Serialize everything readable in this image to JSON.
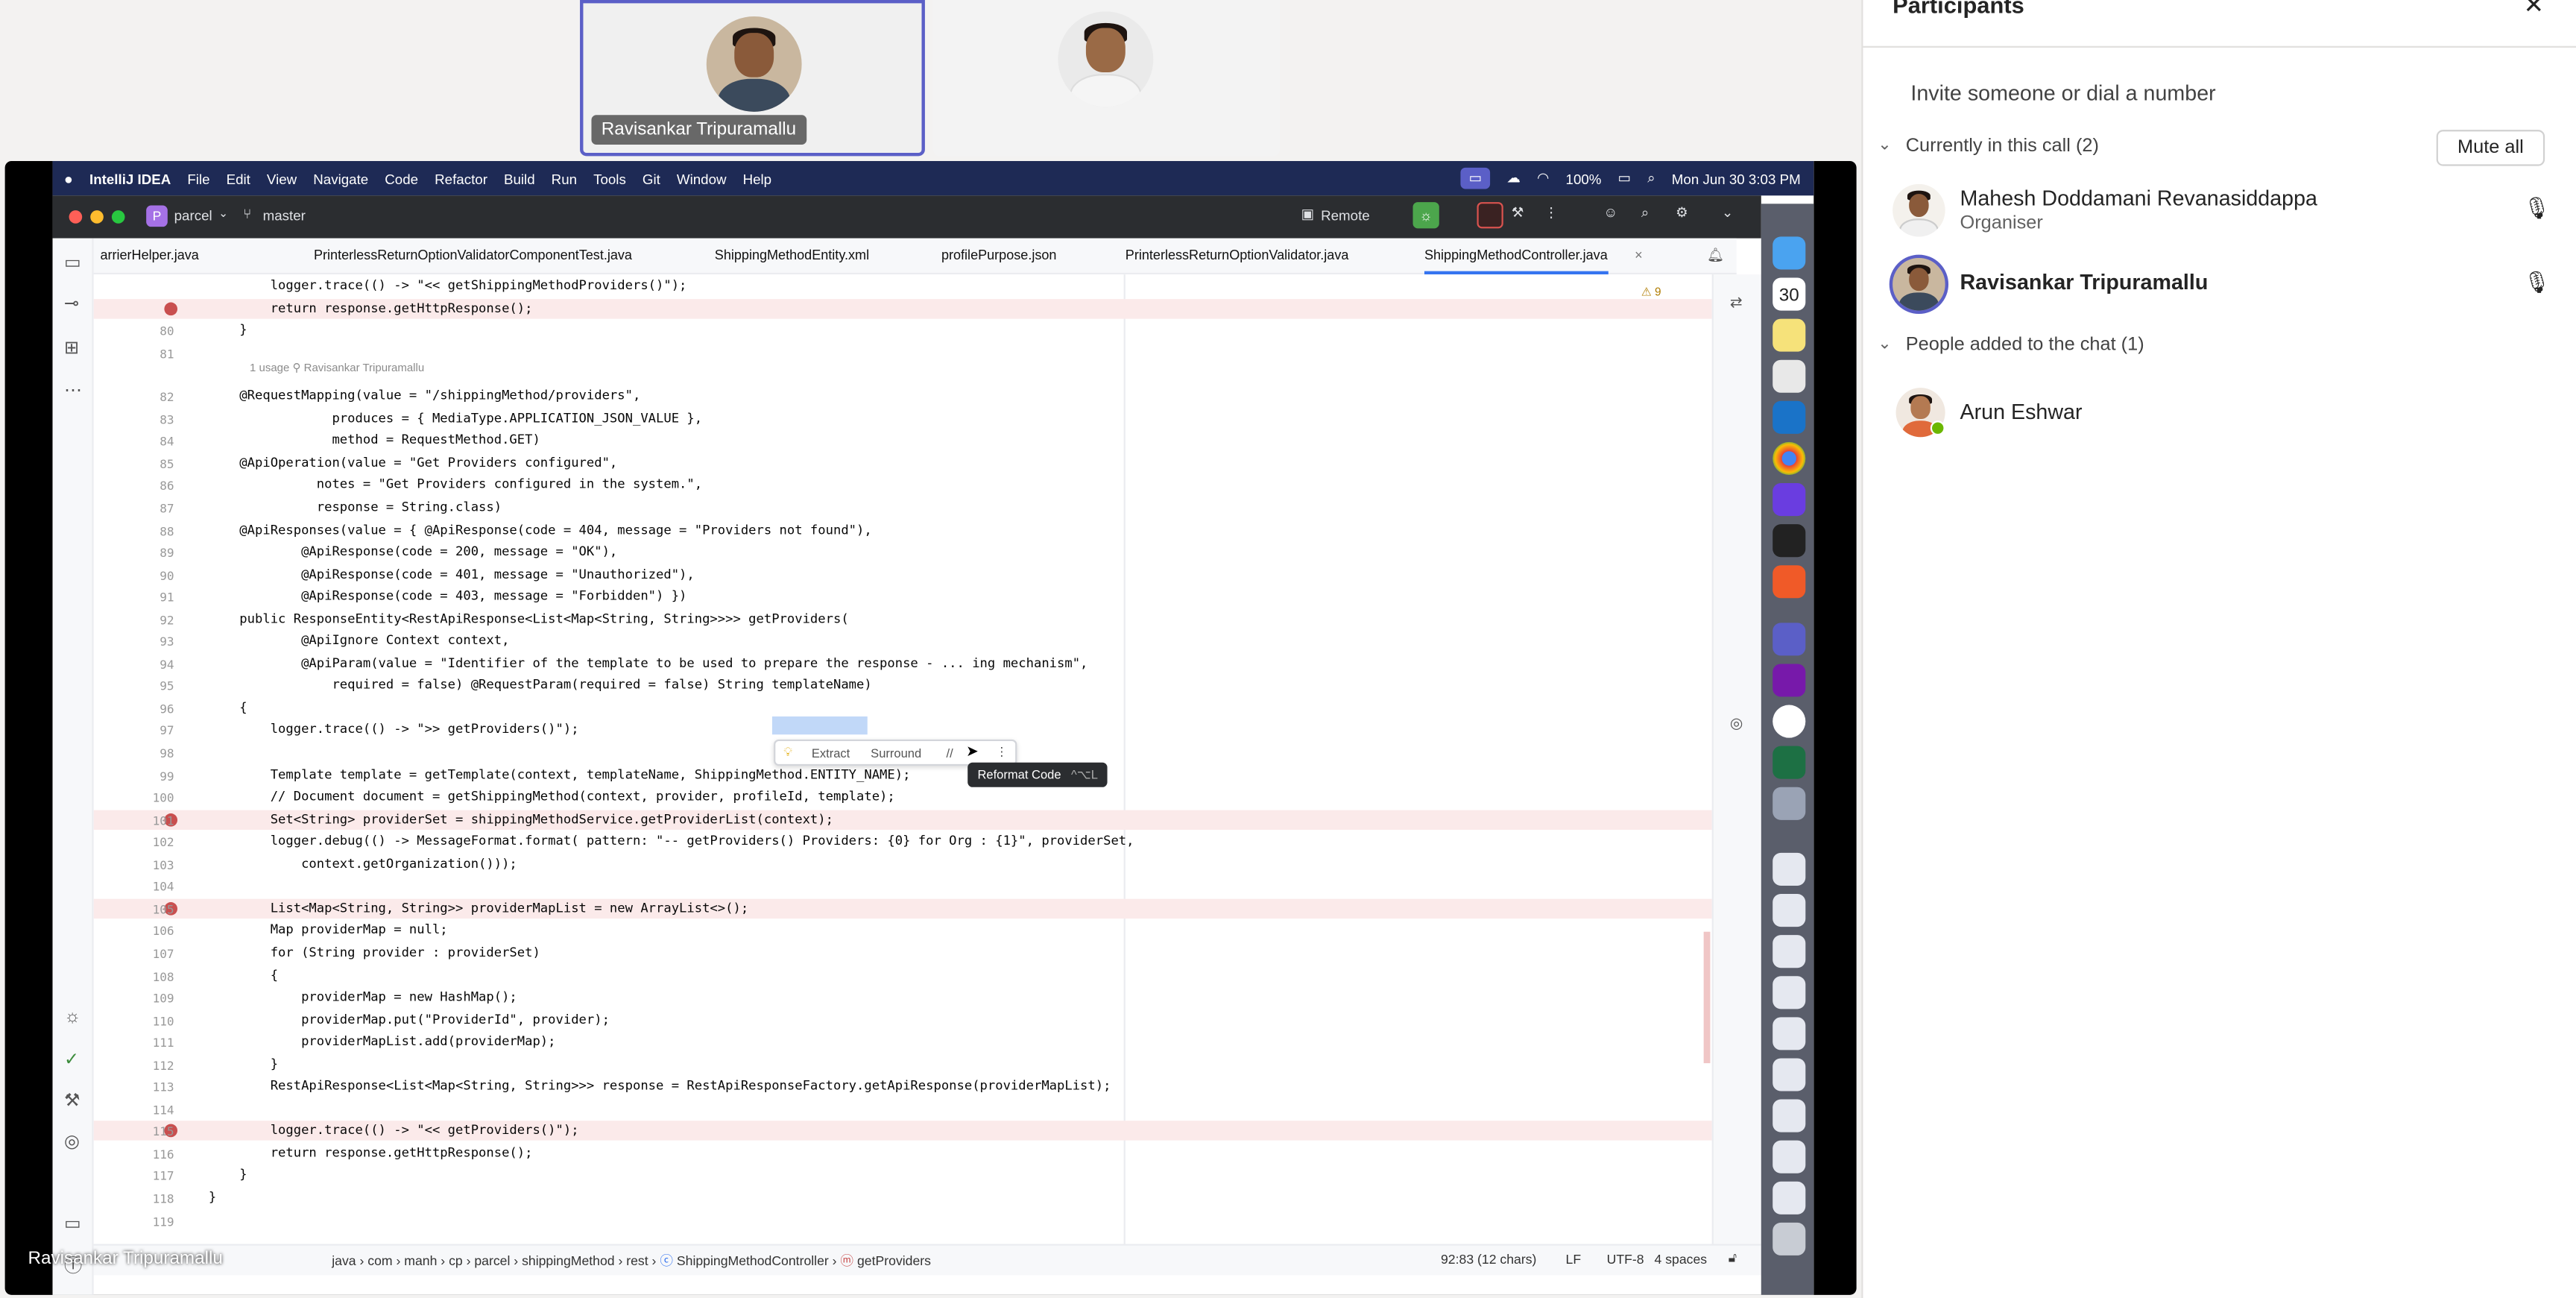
{
  "video_tiles": [
    {
      "name": "Ravisankar Tripuramallu",
      "active": true
    },
    {
      "name": "",
      "active": false
    }
  ],
  "share": {
    "presenter_label": "Ravisankar Tripuramallu",
    "menubar": {
      "app": "IntelliJ IDEA",
      "items": [
        "File",
        "Edit",
        "View",
        "Navigate",
        "Code",
        "Refactor",
        "Build",
        "Run",
        "Tools",
        "Git",
        "Window",
        "Help"
      ],
      "battery": "100%",
      "clock": "Mon Jun 30 3:03 PM"
    },
    "ide": {
      "project": "parcel",
      "project_badge": "P",
      "branch": "master",
      "run_config": "Remote",
      "tabs": [
        "arrierHelper.java",
        "PrinterlessReturnOptionValidatorComponentTest.java",
        "ShippingMethodEntity.xml",
        "profilePurpose.json",
        "PrinterlessReturnOptionValidator.java",
        "ShippingMethodController.java"
      ],
      "active_tab": "ShippingMethodController.java",
      "warnings": "⚠ 9",
      "usage_hint": "1 usage   ⚲ Ravisankar Tripuramallu",
      "code_lines": [
        {
          "n": "",
          "t": "        logger.trace(() -> \"<< getShippingMethodProviders()\");",
          "hl": false,
          "bp": false
        },
        {
          "n": "",
          "t": "        return response.getHttpResponse();",
          "hl": true,
          "bp": true
        },
        {
          "n": "80",
          "t": "    }",
          "hl": false,
          "bp": false
        },
        {
          "n": "81",
          "t": "",
          "hl": false,
          "bp": false
        },
        {
          "n": "82",
          "t": "    @RequestMapping(value = \"/shippingMethod/providers\",",
          "hl": false,
          "bp": false
        },
        {
          "n": "83",
          "t": "                produces = { MediaType.APPLICATION_JSON_VALUE },",
          "hl": false,
          "bp": false
        },
        {
          "n": "84",
          "t": "                method = RequestMethod.GET)",
          "hl": false,
          "bp": false
        },
        {
          "n": "85",
          "t": "    @ApiOperation(value = \"Get Providers configured\",",
          "hl": false,
          "bp": false
        },
        {
          "n": "86",
          "t": "              notes = \"Get Providers configured in the system.\",",
          "hl": false,
          "bp": false
        },
        {
          "n": "87",
          "t": "              response = String.class)",
          "hl": false,
          "bp": false
        },
        {
          "n": "88",
          "t": "    @ApiResponses(value = { @ApiResponse(code = 404, message = \"Providers not found\"),",
          "hl": false,
          "bp": false
        },
        {
          "n": "89",
          "t": "            @ApiResponse(code = 200, message = \"OK\"),",
          "hl": false,
          "bp": false
        },
        {
          "n": "90",
          "t": "            @ApiResponse(code = 401, message = \"Unauthorized\"),",
          "hl": false,
          "bp": false
        },
        {
          "n": "91",
          "t": "            @ApiResponse(code = 403, message = \"Forbidden\") })",
          "hl": false,
          "bp": false
        },
        {
          "n": "92",
          "t": "    public ResponseEntity<RestApiResponse<List<Map<String, String>>>> getProviders(",
          "hl": false,
          "bp": false
        },
        {
          "n": "93",
          "t": "            @ApiIgnore Context context,",
          "hl": false,
          "bp": false
        },
        {
          "n": "94",
          "t": "            @ApiParam(value = \"Identifier of the template to be used to prepare the response - ... ing mechanism\",",
          "hl": false,
          "bp": false
        },
        {
          "n": "95",
          "t": "                required = false) @RequestParam(required = false) String templateName)",
          "hl": false,
          "bp": false
        },
        {
          "n": "96",
          "t": "    {",
          "hl": false,
          "bp": false
        },
        {
          "n": "97",
          "t": "        logger.trace(() -> \">> getProviders()\");",
          "hl": false,
          "bp": false
        },
        {
          "n": "98",
          "t": "",
          "hl": false,
          "bp": false
        },
        {
          "n": "99",
          "t": "        Template template = getTemplate(context, templateName, ShippingMethod.ENTITY_NAME);",
          "hl": false,
          "bp": false
        },
        {
          "n": "100",
          "t": "        // Document document = getShippingMethod(context, provider, profileId, template);",
          "hl": false,
          "bp": false
        },
        {
          "n": "101",
          "t": "        Set<String> providerSet = shippingMethodService.getProviderList(context);",
          "hl": true,
          "bp": true
        },
        {
          "n": "102",
          "t": "        logger.debug(() -> MessageFormat.format( pattern: \"-- getProviders() Providers: {0} for Org : {1}\", providerSet,",
          "hl": false,
          "bp": false
        },
        {
          "n": "103",
          "t": "            context.getOrganization()));",
          "hl": false,
          "bp": false
        },
        {
          "n": "104",
          "t": "",
          "hl": false,
          "bp": false
        },
        {
          "n": "105",
          "t": "        List<Map<String, String>> providerMapList = new ArrayList<>();",
          "hl": true,
          "bp": true
        },
        {
          "n": "106",
          "t": "        Map providerMap = null;",
          "hl": false,
          "bp": false
        },
        {
          "n": "107",
          "t": "        for (String provider : providerSet)",
          "hl": false,
          "bp": false
        },
        {
          "n": "108",
          "t": "        {",
          "hl": false,
          "bp": false
        },
        {
          "n": "109",
          "t": "            providerMap = new HashMap();",
          "hl": false,
          "bp": false
        },
        {
          "n": "110",
          "t": "            providerMap.put(\"ProviderId\", provider);",
          "hl": false,
          "bp": false
        },
        {
          "n": "111",
          "t": "            providerMapList.add(providerMap);",
          "hl": false,
          "bp": false
        },
        {
          "n": "112",
          "t": "        }",
          "hl": false,
          "bp": false
        },
        {
          "n": "113",
          "t": "        RestApiResponse<List<Map<String, String>>> response = RestApiResponseFactory.getApiResponse(providerMapList);",
          "hl": false,
          "bp": false
        },
        {
          "n": "114",
          "t": "",
          "hl": false,
          "bp": false
        },
        {
          "n": "115",
          "t": "        logger.trace(() -> \"<< getProviders()\");",
          "hl": true,
          "bp": true
        },
        {
          "n": "116",
          "t": "        return response.getHttpResponse();",
          "hl": false,
          "bp": false
        },
        {
          "n": "117",
          "t": "    }",
          "hl": false,
          "bp": false
        },
        {
          "n": "118",
          "t": "}",
          "hl": false,
          "bp": false
        },
        {
          "n": "119",
          "t": "",
          "hl": false,
          "bp": false
        }
      ],
      "popup": {
        "extract": "Extract",
        "surround": "Surround",
        "tooltip": "Reformat Code",
        "shortcut": "^⌥L"
      },
      "status": {
        "path": [
          "java",
          "com",
          "manh",
          "cp",
          "parcel",
          "shippingMethod",
          "rest",
          "ShippingMethodController",
          "getProviders"
        ],
        "position": "92:83 (12 chars)",
        "line_sep": "LF",
        "encoding": "UTF-8",
        "indent": "4 spaces"
      },
      "dock_calendar_day": "30"
    }
  },
  "participants": {
    "title": "Participants",
    "invite": "Invite someone or dial a number",
    "mute_all": "Mute all",
    "in_call_header": "Currently in this call (2)",
    "in_call": [
      {
        "name": "Mahesh Doddamani Revanasiddappa",
        "role": "Organiser"
      },
      {
        "name": "Ravisankar Tripuramallu",
        "role": ""
      }
    ],
    "added_header": "People added to the chat (1)",
    "added": [
      {
        "name": "Arun Eshwar"
      }
    ]
  },
  "colors": {
    "accent": "#5b5fc7",
    "ide_dark": "#2b2d30",
    "menubar": "#1e2a55",
    "breakpoint": "#c94f4f",
    "line_highlight": "#fbeaea"
  }
}
